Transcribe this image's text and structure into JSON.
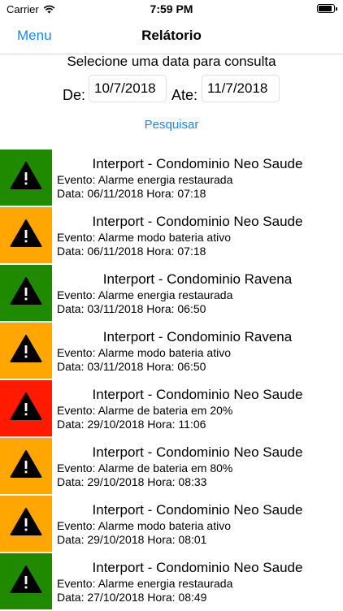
{
  "status": {
    "carrier": "Carrier",
    "time": "7:59 PM",
    "battery_level": 0.9
  },
  "nav": {
    "menu_label": "Menu",
    "title": "Relátorio"
  },
  "form": {
    "prompt": "Selecione uma data para consulta",
    "from_label": "De:",
    "from_value": "10/7/2018",
    "to_label": "Ate:",
    "to_value": "11/7/2018",
    "search_label": "Pesquisar"
  },
  "colors": {
    "green": "#1f8a00",
    "orange": "#ffa600",
    "red": "#ff1a00",
    "accent": "#1a86f0"
  },
  "events": [
    {
      "color": "green",
      "title": "Interport - Condominio Neo Saude",
      "event": "Evento: Alarme energia restaurada",
      "date": "Data: 06/11/2018 Hora: 07:18"
    },
    {
      "color": "orange",
      "title": "Interport - Condominio Neo Saude",
      "event": "Evento: Alarme modo bateria ativo",
      "date": "Data: 06/11/2018 Hora: 07:18"
    },
    {
      "color": "green",
      "title": "Interport - Condominio Ravena",
      "event": "Evento: Alarme energia restaurada",
      "date": "Data: 03/11/2018 Hora: 06:50"
    },
    {
      "color": "orange",
      "title": "Interport - Condominio Ravena",
      "event": "Evento: Alarme modo bateria ativo",
      "date": "Data: 03/11/2018 Hora: 06:50"
    },
    {
      "color": "red",
      "title": "Interport - Condominio Neo Saude",
      "event": "Evento: Alarme de bateria em 20%",
      "date": "Data: 29/10/2018 Hora: 11:06"
    },
    {
      "color": "orange",
      "title": "Interport - Condominio Neo Saude",
      "event": "Evento: Alarme de bateria em 80%",
      "date": "Data: 29/10/2018 Hora: 08:33"
    },
    {
      "color": "orange",
      "title": "Interport - Condominio Neo Saude",
      "event": "Evento: Alarme modo bateria ativo",
      "date": "Data: 29/10/2018 Hora: 08:01"
    },
    {
      "color": "green",
      "title": "Interport - Condominio Neo Saude",
      "event": "Evento: Alarme energia restaurada",
      "date": "Data: 27/10/2018 Hora: 08:49"
    }
  ]
}
